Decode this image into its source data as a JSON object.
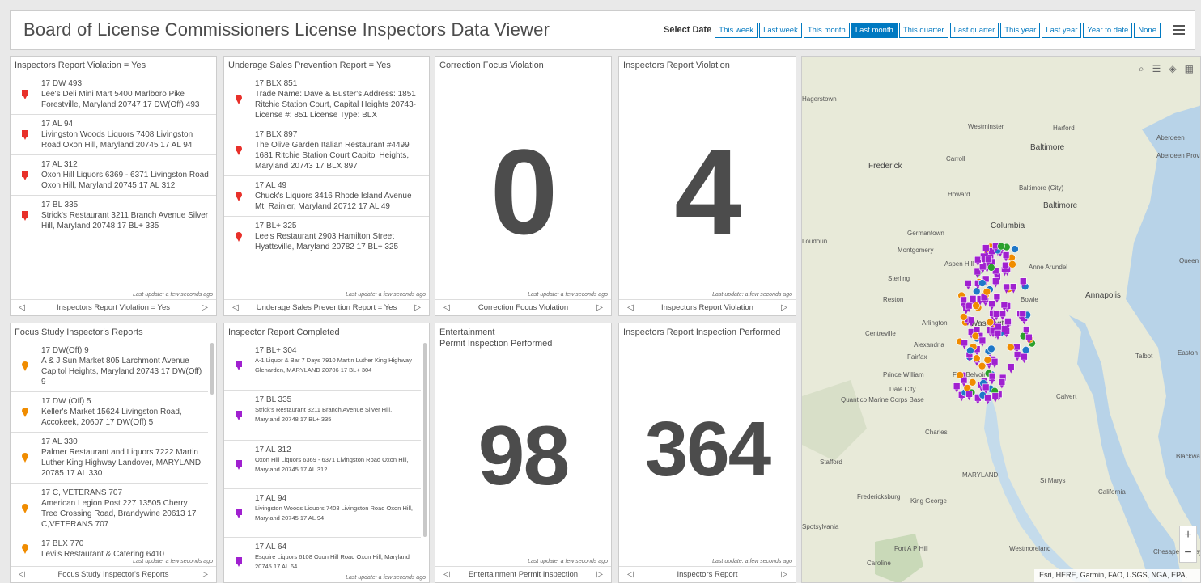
{
  "header": {
    "title": "Board of License Commissioners License Inspectors Data Viewer",
    "select_date_label": "Select Date",
    "date_options": [
      "This week",
      "Last week",
      "This month",
      "Last month",
      "This quarter",
      "Last quarter",
      "This year",
      "Last year",
      "Year to date",
      "None"
    ],
    "active_option": "Last month"
  },
  "panel1": {
    "title": "Inspectors Report Violation = Yes",
    "items": [
      {
        "line1": "17 DW 493",
        "line2": "Lee's Deli Mini Mart 5400 Marlboro Pike Forestville, Maryland 20747 17 DW(Off) 493"
      },
      {
        "line1": "17 AL 94",
        "line2": "Livingston Woods Liquors 7408 Livingston Road Oxon Hill, Maryland 20745 17 AL 94"
      },
      {
        "line1": "17 AL 312",
        "line2": "Oxon Hill Liquors 6369 - 6371 Livingston Road Oxon Hill, Maryland 20745 17 AL 312"
      },
      {
        "line1": "17 BL 335",
        "line2": "Strick's Restaurant 3211 Branch Avenue Silver Hill, Maryland 20748 17 BL+ 335"
      }
    ],
    "last_update": "Last update: a few seconds ago",
    "footer": "Inspectors Report Violation = Yes"
  },
  "panel2": {
    "title": "Underage Sales Prevention Report = Yes",
    "items": [
      {
        "line1": "17 BLX 851",
        "line2": "Trade Name: Dave & Buster's Address: 1851 Ritchie Station Court, Capital Heights 20743- License #: 851 License Type: BLX"
      },
      {
        "line1": "17 BLX 897",
        "line2": "The Olive Garden Italian Restaurant #4499 1681 Ritchie Station Court Capitol Heights, Maryland 20743 17 BLX 897"
      },
      {
        "line1": "17 AL 49",
        "line2": "Chuck's Liquors 3416 Rhode Island Avenue Mt. Rainier, Maryland 20712 17 AL 49"
      },
      {
        "line1": "17 BL+ 325",
        "line2": "Lee's Restaurant 2903 Hamilton Street Hyattsville, Maryland 20782 17 BL+ 325"
      }
    ],
    "last_update": "Last update: a few seconds ago",
    "footer": "Underage Sales Prevention Report = Yes"
  },
  "panel3": {
    "title": "Correction Focus Violation",
    "value": "0",
    "last_update": "Last update: a few seconds ago",
    "footer": "Correction Focus Violation"
  },
  "panel4": {
    "title": "Inspectors Report Violation",
    "value": "4",
    "last_update": "Last update: a few seconds ago",
    "footer": "Inspectors Report Violation"
  },
  "panel5": {
    "title": "Focus Study Inspector's Reports",
    "items": [
      {
        "line1": "17 DW(Off) 9",
        "line2": "A & J Sun Market 805 Larchmont Avenue Capitol Heights, Maryland 20743 17 DW(Off) 9"
      },
      {
        "line1": "17 DW (Off) 5",
        "line2": "Keller's Market 15624 Livingston Road, Accokeek, 20607 17 DW(Off) 5"
      },
      {
        "line1": "17 AL 330",
        "line2": "Palmer Restaurant and Liquors 7222 Martin Luther King Highway Landover, MARYLAND 20785 17 AL 330"
      },
      {
        "line1": "17 C, VETERANS 707",
        "line2": "American Legion Post 227 13505 Cherry Tree Crossing Road, Brandywine 20613 17 C,VETERANS 707"
      },
      {
        "line1": "17 BLX 770",
        "line2": "Levi's Restaurant & Catering 6410"
      }
    ],
    "last_update": "Last update: a few seconds ago",
    "footer": "Focus Study Inspector's Reports"
  },
  "panel6": {
    "title": "Inspector Report Completed",
    "items": [
      {
        "line1": "17 BL+ 304",
        "line2": "A-1 Liquor & Bar 7 Days 7910 Martin Luther King Highway Glenarden, MARYLAND 20706 17 BL+ 304"
      },
      {
        "line1": "17 BL 335",
        "line2": "Strick's Restaurant 3211 Branch Avenue Silver Hill, Maryland 20748 17 BL+ 335"
      },
      {
        "line1": "17 AL 312",
        "line2": "Oxon Hill Liquors 6369 - 6371 Livingston Road Oxon Hill, Maryland 20745 17 AL 312"
      },
      {
        "line1": "17 AL 94",
        "line2": "Livingston Woods Liquors 7408 Livingston Road Oxon Hill, Maryland 20745 17 AL 94"
      },
      {
        "line1": "17 AL 64",
        "line2": "Esquire Liquors 6108 Oxon Hill Road Oxon Hill, Maryland 20745 17 AL 64"
      }
    ],
    "last_update": "Last update: a few seconds ago"
  },
  "panel7": {
    "title": "Entertainment",
    "subtitle": "Permit Inspection Performed",
    "value": "98",
    "last_update": "Last update: a few seconds ago",
    "footer": "Entertainment Permit Inspection"
  },
  "panel8": {
    "title": "Inspectors Report Inspection Performed",
    "value": "364",
    "last_update": "Last update: a few seconds ago",
    "footer": "Inspectors Report"
  },
  "map": {
    "attribution": "Esri, HERE, Garmin, FAO, USGS, NGA, EPA, ...",
    "places": [
      "Hagerstown",
      "Westminster",
      "Harford",
      "Aberdeen",
      "Frederick",
      "Carroll",
      "Baltimore",
      "Baltimore (City)",
      "Aberdeen Proving Ground",
      "Howard",
      "Columbia",
      "Germantown",
      "Montgomery",
      "Aspen Hill",
      "Anne Arundel",
      "Queen",
      "Loudoun",
      "Sterling",
      "Reston",
      "Bowie",
      "Annapolis",
      "Arlington",
      "Washington",
      "Centreville",
      "Alexandria",
      "Fairfax",
      "Talbot",
      "Easton",
      "Prince William",
      "Fort Belvoir",
      "Dale City",
      "Quantico Marine Corps Base",
      "Calvert",
      "Charles",
      "Stafford",
      "Blackwater National Wildlife Refuge",
      "MARYLAND",
      "St Marys",
      "California",
      "Fredericksburg",
      "King George",
      "Fort A P Hill",
      "Westmoreland",
      "Caroline",
      "Chesapeake Bay",
      "Spotsylvania"
    ],
    "colors": {
      "purple": "#a020d0",
      "orange": "#f08c00",
      "blue": "#1f78c8",
      "green": "#2ca02c",
      "red": "#e02020"
    }
  }
}
